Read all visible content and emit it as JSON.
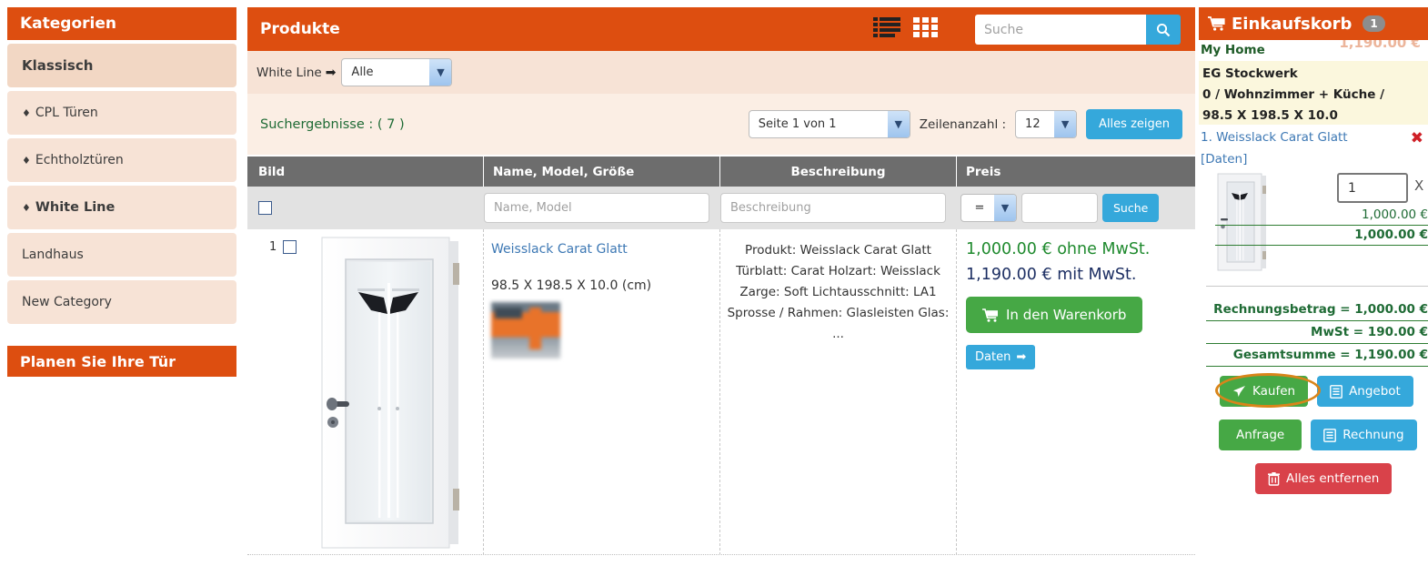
{
  "sidebar": {
    "header": "Kategorien",
    "items": [
      {
        "label": "Klassisch",
        "bullet": "",
        "state": "selected"
      },
      {
        "label": "CPL Türen",
        "bullet": "♦",
        "state": "normal"
      },
      {
        "label": "Echtholztüren",
        "bullet": "♦",
        "state": "normal"
      },
      {
        "label": "White Line",
        "bullet": "♦",
        "state": "active"
      },
      {
        "label": "Landhaus",
        "bullet": "",
        "state": "normal"
      },
      {
        "label": "New Category",
        "bullet": "",
        "state": "normal"
      }
    ],
    "plan_header": "Planen Sie Ihre Tür"
  },
  "main": {
    "title": "Produkte",
    "view_list_icon": "list-view-icon",
    "view_grid_icon": "grid-view-icon",
    "search": {
      "placeholder": "Suche",
      "value": "",
      "button_icon": "search-icon"
    },
    "filter": {
      "label": "White Line",
      "arrow": "➡",
      "select_value": "Alle",
      "options": [
        "Alle"
      ]
    },
    "results": {
      "text": "Suchergebnisse : ( 7 )",
      "page_select_value": "Seite 1 von 1",
      "rows_label": "Zeilenanzahl :",
      "rows_select_value": "12",
      "show_all_button": "Alles zeigen"
    },
    "table": {
      "headers": [
        "Bild",
        "Name, Model, Größe",
        "Beschreibung",
        "Preis"
      ],
      "filter_row": {
        "checkbox_checked": false,
        "name_placeholder": "Name, Model",
        "desc_placeholder": "Beschreibung",
        "operator_value": "=",
        "operator_options": [
          "=",
          ">",
          "<"
        ],
        "price_value": "",
        "search_button": "Suche"
      },
      "rows": [
        {
          "index": "1",
          "checkbox_checked": false,
          "image_name": "product-door-image",
          "name": "Weisslack Carat Glatt",
          "dimensions": "98.5 X 198.5 X 10.0 (cm)",
          "brand_logo": "brand-logo-thumbnail",
          "description": [
            "Produkt: Weisslack Carat Glatt",
            "Türblatt: Carat Holzart: Weisslack",
            "Zarge: Soft Lichtausschnitt: LA1",
            "Sprosse / Rahmen: Glasleisten Glas:",
            "..."
          ],
          "price_net": "1,000.00 € ohne MwSt.",
          "price_gross": "1,190.00 € mit MwSt.",
          "add_to_cart_button": "In den Warenkorb",
          "data_button": "Daten"
        }
      ]
    }
  },
  "cart": {
    "title": "Einkaufskorb",
    "badge": "1",
    "ghost_amount": "1,190.00 €",
    "home_label": "My Home",
    "location_lines": [
      "EG Stockwerk",
      "0 / Wohnzimmer + Küche /",
      "98.5 X 198.5 X 10.0"
    ],
    "item": {
      "title": "1. Weisslack Carat Glatt",
      "data_link": "[Daten]",
      "remove_icon": "✖",
      "thumb_name": "cart-item-thumbnail",
      "quantity": "1",
      "multiplier": "X",
      "unit_price": "1,000.00 €",
      "line_total": "1,000.00 €"
    },
    "totals": [
      "Rechnungsbetrag = 1,000.00 €",
      "MwSt = 190.00 €",
      "Gesamtsumme = 1,190.00 €"
    ],
    "buttons": {
      "buy": "Kaufen",
      "offer": "Angebot",
      "inquiry": "Anfrage",
      "invoice": "Rechnung",
      "remove_all": "Alles entfernen"
    },
    "highlight_color": "#d9851a"
  }
}
